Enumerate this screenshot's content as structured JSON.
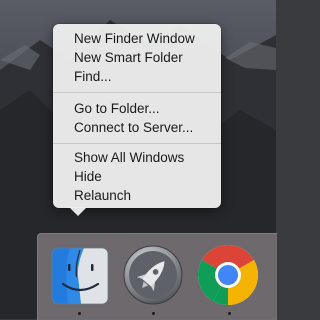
{
  "context_menu": {
    "groups": [
      [
        "New Finder Window",
        "New Smart Folder",
        "Find..."
      ],
      [
        "Go to Folder...",
        "Connect to Server..."
      ],
      [
        "Show All Windows",
        "Hide",
        "Relaunch"
      ]
    ]
  },
  "dock": {
    "apps": [
      {
        "icon": "finder-icon",
        "running": true
      },
      {
        "icon": "launchpad-icon",
        "running": true
      },
      {
        "icon": "chrome-icon",
        "running": true
      }
    ]
  },
  "colors": {
    "menu_bg": "#ececec",
    "menu_text": "#1a1a1a",
    "dock_bg": "#827c80"
  }
}
